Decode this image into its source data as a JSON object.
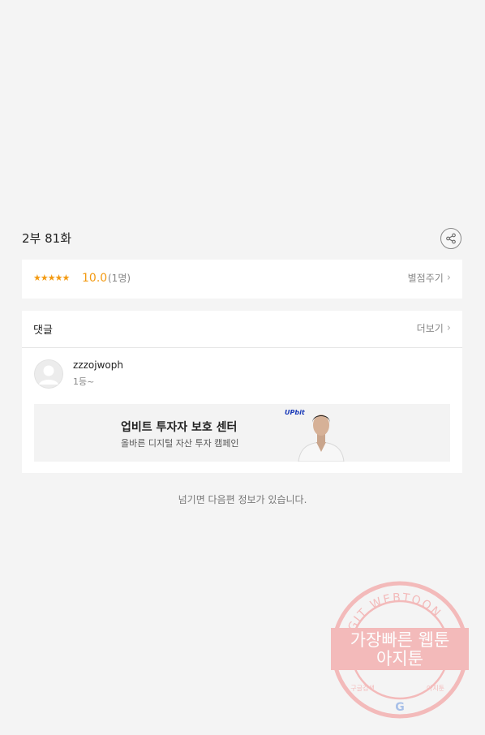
{
  "episode": {
    "title": "2부 81화"
  },
  "rating": {
    "stars": "★★★★★",
    "score": "10.0",
    "count": "(1명)",
    "rate_link": "별점주기",
    "chevron": "›"
  },
  "comments": {
    "label": "댓글",
    "more_link": "더보기",
    "chevron": "›",
    "items": [
      {
        "username": "zzzojwoph",
        "text": "1등~"
      }
    ]
  },
  "ad": {
    "logo": "UPbit",
    "title": "업비트 투자자 보호 센터",
    "subtitle": "올바른 디지털 자산 투자 캠페인"
  },
  "next_notice": "넘기면 다음편 정보가 있습니다.",
  "watermark": {
    "arc_text": "AGIT WEBTOON",
    "line1": "가장빠른 웹툰",
    "line2": "아지툰",
    "bottom_left": "구글검색",
    "bottom_right": "아지툰",
    "g": "G"
  },
  "colors": {
    "accent_orange": "#f39a12",
    "watermark_pink": "#f0a0a0",
    "background": "#f4f4f4"
  },
  "icons": [
    "share-icon",
    "chevron-right-icon",
    "avatar-placeholder-icon"
  ]
}
